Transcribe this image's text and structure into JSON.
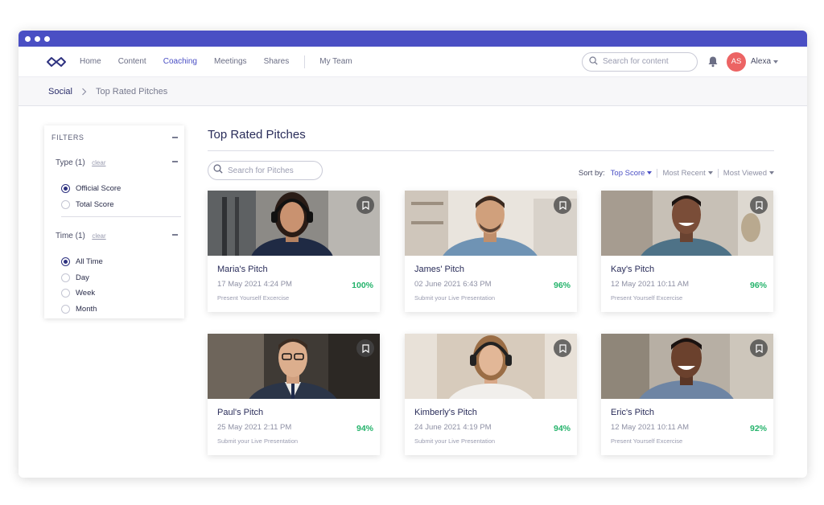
{
  "colors": {
    "accent": "#4a4fc4",
    "score": "#24b36b",
    "avatar": "#ec6464"
  },
  "nav": {
    "items": [
      {
        "label": "Home",
        "active": false
      },
      {
        "label": "Content",
        "active": false
      },
      {
        "label": "Coaching",
        "active": true
      },
      {
        "label": "Meetings",
        "active": false
      },
      {
        "label": "Shares",
        "active": false
      }
    ],
    "my_team": "My Team",
    "search_placeholder": "Search for content",
    "user": {
      "initials": "AS",
      "name": "Alexa"
    }
  },
  "breadcrumb": {
    "root": "Social",
    "current": "Top Rated Pitches"
  },
  "filters": {
    "title": "FILTERS",
    "type": {
      "title": "Type (1)",
      "clear": "clear",
      "options": [
        "Official Score",
        "Total Score"
      ],
      "selected": "Official Score"
    },
    "time": {
      "title": "Time (1)",
      "clear": "clear",
      "options": [
        "All Time",
        "Day",
        "Week",
        "Month"
      ],
      "selected": "All Time"
    }
  },
  "main": {
    "title": "Top Rated Pitches",
    "search_placeholder": "Search for Pitches",
    "sort": {
      "label": "Sort by:",
      "options": [
        "Top Score",
        "Most Recent",
        "Most Viewed"
      ],
      "active": "Top Score"
    }
  },
  "pitches": [
    {
      "title": "Maria's Pitch",
      "date": "17 May 2021 4:24 PM",
      "subtitle": "Present Yourself Excercise",
      "score": "100%"
    },
    {
      "title": "James' Pitch",
      "date": "02 June 2021 6:43 PM",
      "subtitle": "Submit your Live Presentation",
      "score": "96%"
    },
    {
      "title": "Kay's Pitch",
      "date": "12 May 2021 10:11 AM",
      "subtitle": "Present Yourself Excercise",
      "score": "96%"
    },
    {
      "title": "Paul's Pitch",
      "date": "25 May 2021 2:11 PM",
      "subtitle": "Submit your Live Presentation",
      "score": "94%"
    },
    {
      "title": "Kimberly's Pitch",
      "date": "24 June 2021 4:19 PM",
      "subtitle": "Submit your Live Presentation",
      "score": "94%"
    },
    {
      "title": "Eric's Pitch",
      "date": "12 May 2021 10:11 AM",
      "subtitle": "Present Yourself Excercise",
      "score": "92%"
    }
  ]
}
